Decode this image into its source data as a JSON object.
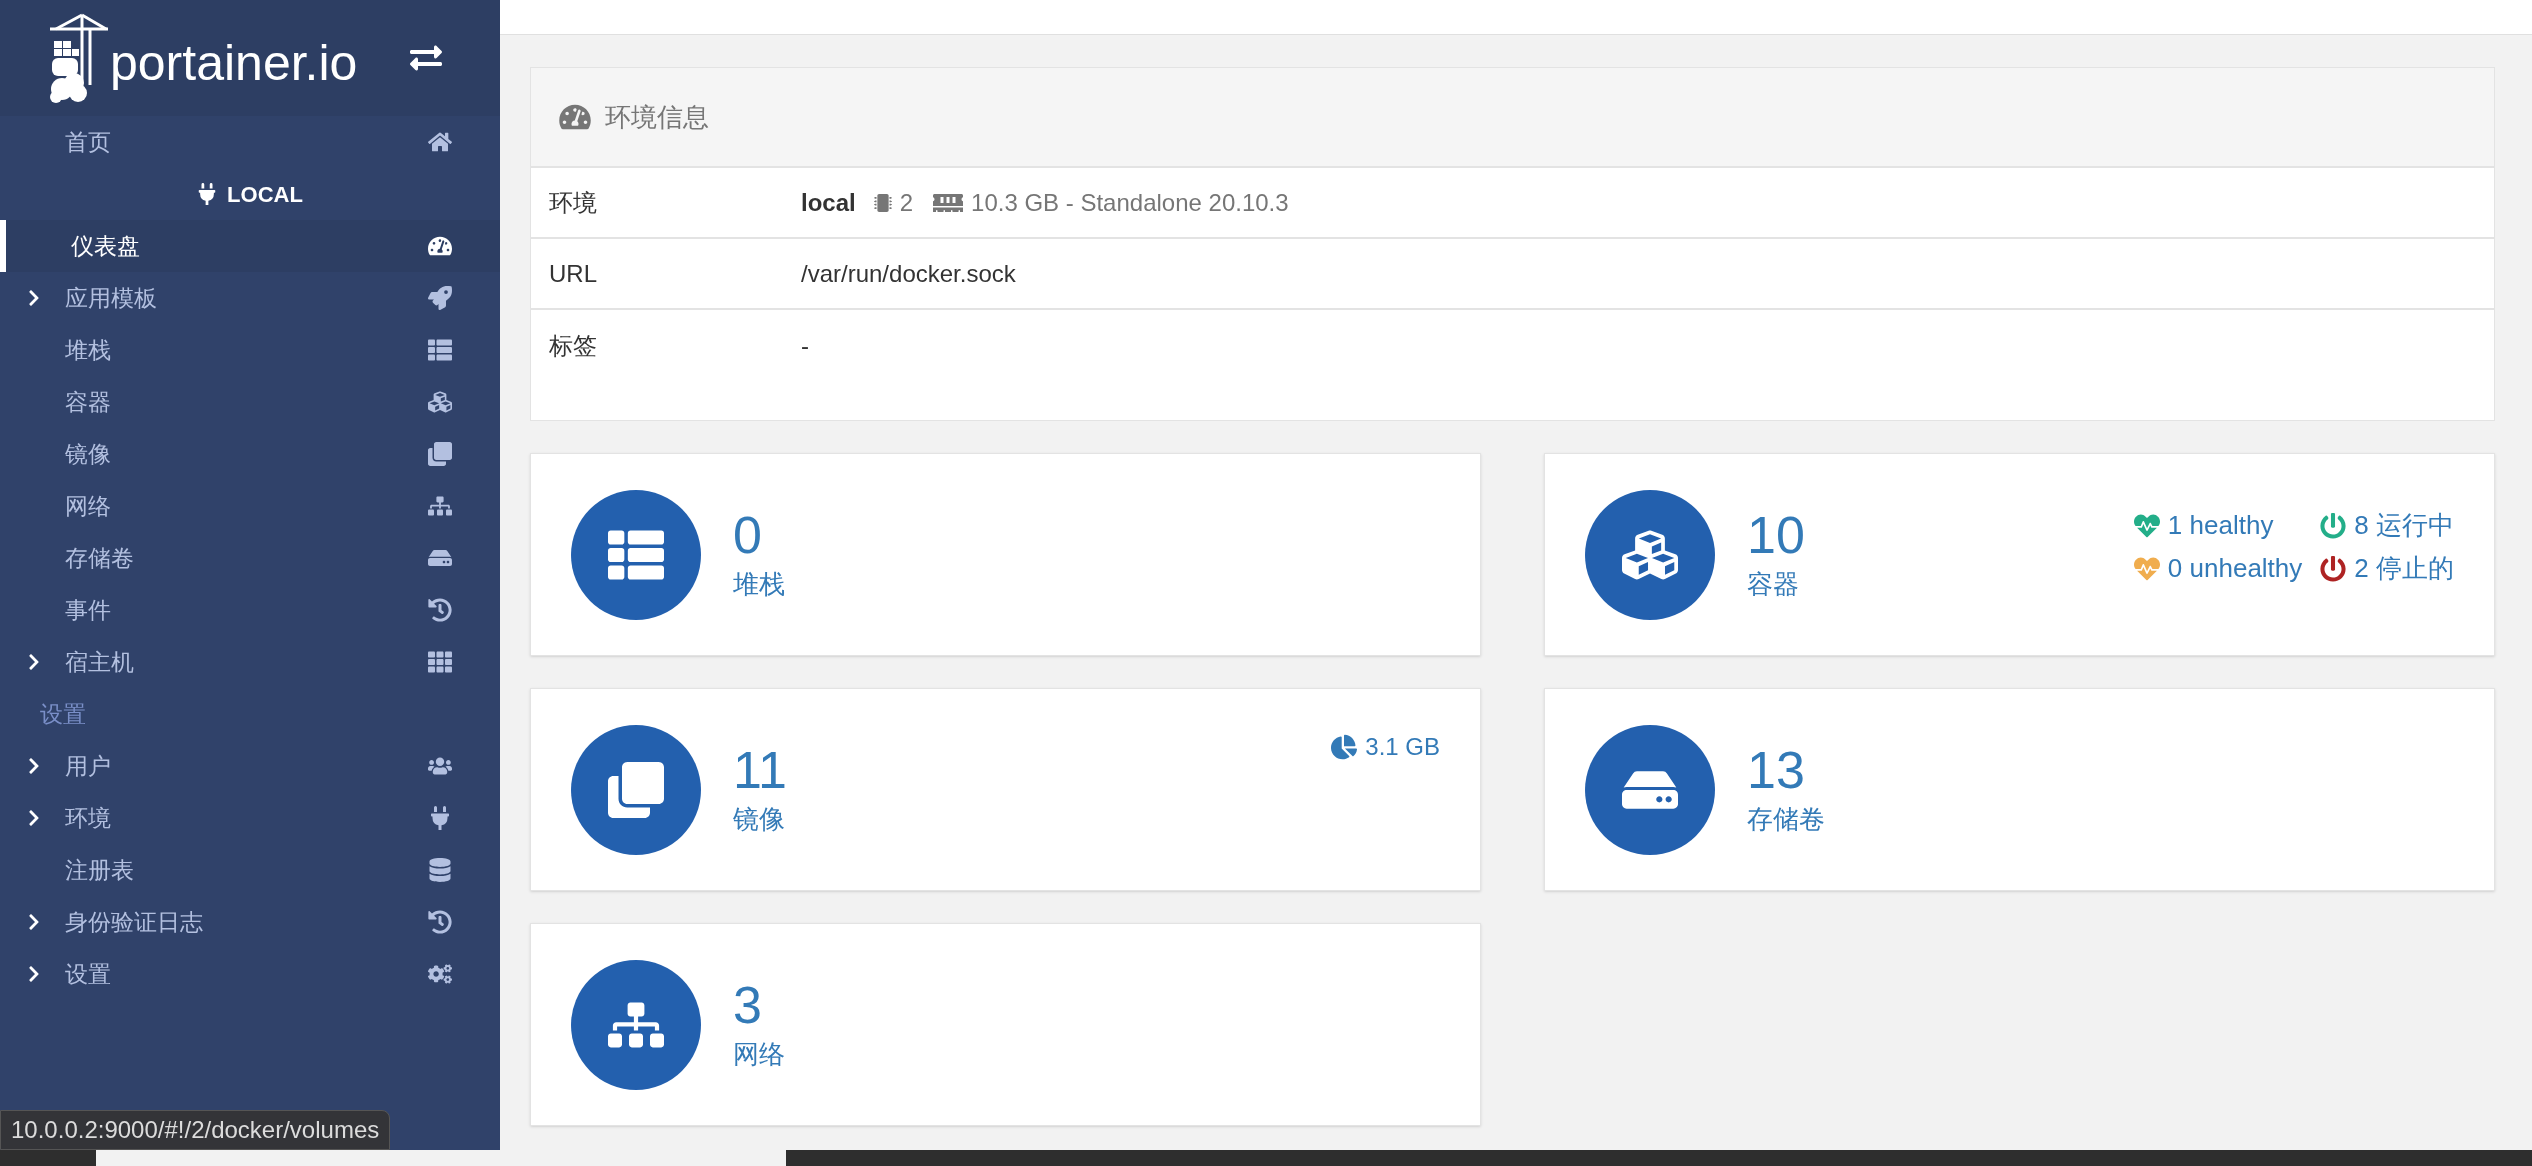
{
  "sidebar": {
    "logo_text": "portainer.io",
    "home": {
      "label": "首页",
      "expandable": false,
      "selected": false
    },
    "endpoint_heading": "LOCAL",
    "items": [
      {
        "label": "仪表盘",
        "expandable": false,
        "selected": true
      },
      {
        "label": "应用模板",
        "expandable": true,
        "selected": false
      },
      {
        "label": "堆栈",
        "expandable": false,
        "selected": false
      },
      {
        "label": "容器",
        "expandable": false,
        "selected": false
      },
      {
        "label": "镜像",
        "expandable": false,
        "selected": false
      },
      {
        "label": "网络",
        "expandable": false,
        "selected": false
      },
      {
        "label": "存储卷",
        "expandable": false,
        "selected": false
      },
      {
        "label": "事件",
        "expandable": false,
        "selected": false
      },
      {
        "label": "宿主机",
        "expandable": true,
        "selected": false
      }
    ],
    "settings_heading": "设置",
    "settings_items": [
      {
        "label": "用户",
        "expandable": true,
        "selected": false
      },
      {
        "label": "环境",
        "expandable": true,
        "selected": false
      },
      {
        "label": "注册表",
        "expandable": false,
        "selected": false
      },
      {
        "label": "身份验证日志",
        "expandable": true,
        "selected": false
      },
      {
        "label": "设置",
        "expandable": true,
        "selected": false
      }
    ]
  },
  "env_panel": {
    "title": "环境信息",
    "rows": [
      {
        "kind": "environment",
        "label": "环境",
        "name": "local",
        "cpus": "2",
        "details": "10.3 GB - Standalone 20.10.3"
      },
      {
        "kind": "text",
        "label": "URL",
        "value": "/var/run/docker.sock"
      },
      {
        "kind": "text",
        "label": "标签",
        "value": "-"
      }
    ]
  },
  "widgets": [
    {
      "kind": "stacks",
      "count": "0",
      "label": "堆栈"
    },
    {
      "kind": "containers",
      "count": "10",
      "label": "容器",
      "status": [
        {
          "kind": "heart",
          "text": "1 healthy",
          "color": "#23ae89"
        },
        {
          "kind": "power",
          "text": "8 运行中",
          "color": "#23ae89"
        },
        {
          "kind": "heart",
          "text": "0 unhealthy",
          "color": "#f0ad4e"
        },
        {
          "kind": "power",
          "text": "2 停止的",
          "color": "#ae2323"
        }
      ]
    },
    {
      "kind": "images",
      "count": "11",
      "label": "镜像",
      "size": "3.1 GB"
    },
    {
      "kind": "volumes",
      "count": "13",
      "label": "存储卷"
    },
    {
      "kind": "networks",
      "count": "3",
      "label": "网络"
    }
  ],
  "status_url": "10.0.0.2:9000/#!/2/docker/volumes"
}
